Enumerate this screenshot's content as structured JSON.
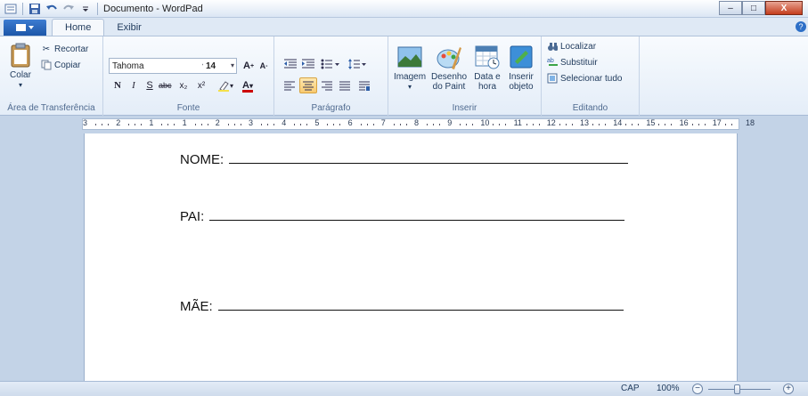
{
  "window": {
    "title": "Documento - WordPad",
    "buttons": {
      "minimize": "–",
      "maximize": "□",
      "close": "X"
    }
  },
  "quick_access": {
    "icons": [
      "app-icon",
      "save-icon",
      "undo-icon",
      "redo-icon",
      "customize-icon"
    ]
  },
  "tabs": [
    {
      "label": "Home",
      "active": true
    },
    {
      "label": "Exibir",
      "active": false
    }
  ],
  "ribbon": {
    "clipboard": {
      "label": "Área de Transferência",
      "paste": "Colar",
      "cut": "Recortar",
      "copy": "Copiar"
    },
    "font": {
      "label": "Fonte",
      "family": "Tahoma",
      "size": "14",
      "grow": "A",
      "shrink": "A",
      "bold": "N",
      "italic": "I",
      "underline": "S",
      "strikethrough": "abc",
      "subscript": "x₂",
      "superscript": "x²",
      "font_color": "A"
    },
    "paragraph": {
      "label": "Parágrafo"
    },
    "insert": {
      "label": "Inserir",
      "picture": "Imagem",
      "paint_line1": "Desenho",
      "paint_line2": "do Paint",
      "datetime_line1": "Data e",
      "datetime_line2": "hora",
      "object_line1": "Inserir",
      "object_line2": "objeto"
    },
    "editing": {
      "label": "Editando",
      "find": "Localizar",
      "replace": "Substituir",
      "select_all": "Selecionar tudo"
    }
  },
  "ruler": {
    "labels": [
      "3",
      "2",
      "1",
      "1",
      "2",
      "3",
      "4",
      "5",
      "6",
      "7",
      "8",
      "9",
      "10",
      "11",
      "12",
      "13",
      "14",
      "15",
      "16",
      "17",
      "18"
    ]
  },
  "document": {
    "fields": [
      {
        "label": "NOME:"
      },
      {
        "label": "PAI:"
      },
      {
        "label": "MÃE:"
      }
    ]
  },
  "status": {
    "caps": "CAP",
    "zoom": "100%",
    "zoom_out": "−",
    "zoom_in": "+",
    "zoom_level": 1.0
  },
  "colors": {
    "ribbon_bg": "#e4edf8",
    "canvas_bg": "#c3d3e7",
    "active_toggle": "#f8c970",
    "close_button": "#c43c1c"
  }
}
